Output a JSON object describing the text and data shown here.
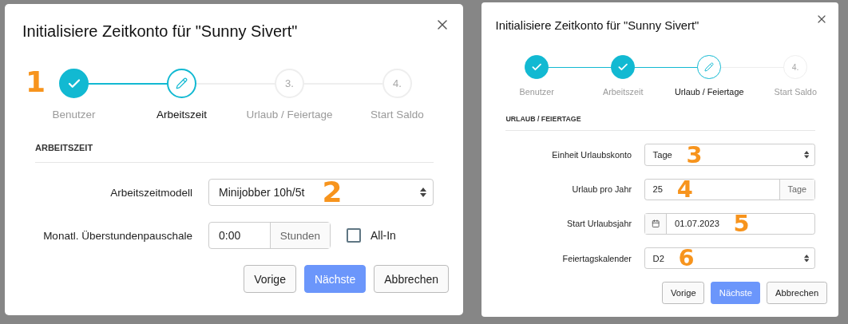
{
  "panels": [
    {
      "title": "Initialisiere Zeitkonto für \"Sunny Sivert\"",
      "step_annotation": "1",
      "steps": [
        {
          "label": "Benutzer",
          "done": true,
          "selected": false
        },
        {
          "label": "Arbeitszeit",
          "done": false,
          "selected": true
        },
        {
          "label": "Urlaub / Feiertage",
          "done": false,
          "selected": false,
          "number": "3."
        },
        {
          "label": "Start Saldo",
          "done": false,
          "selected": false,
          "number": "4."
        }
      ],
      "section": "ARBEITSZEIT",
      "fields": [
        {
          "kind": "select",
          "label": "Arbeitszeitmodell",
          "value": "Minijobber 10h/5t",
          "annotation": "2"
        },
        {
          "kind": "unit",
          "label": "Monatl. Überstundenpauschale",
          "value": "0:00",
          "unit": "Stunden",
          "checkbox": {
            "label": "All-In",
            "checked": false
          }
        }
      ],
      "buttons": [
        {
          "label": "Vorige",
          "kind": "secondary"
        },
        {
          "label": "Nächste",
          "kind": "primary"
        },
        {
          "label": "Abbrechen",
          "kind": "secondary"
        }
      ]
    },
    {
      "title": "Initialisiere Zeitkonto für \"Sunny Sivert\"",
      "steps": [
        {
          "label": "Benutzer",
          "done": true,
          "selected": false
        },
        {
          "label": "Arbeitszeit",
          "done": true,
          "selected": false
        },
        {
          "label": "Urlaub / Feiertage",
          "done": false,
          "selected": true
        },
        {
          "label": "Start Saldo",
          "done": false,
          "selected": false,
          "number": "4."
        }
      ],
      "section": "URLAUB / FEIERTAGE",
      "fields": [
        {
          "kind": "select",
          "label": "Einheit Urlaubskonto",
          "value": "Tage",
          "annotation": "3"
        },
        {
          "kind": "unit",
          "label": "Urlaub pro Jahr",
          "value": "25",
          "unit": "Tage",
          "annotation": "4"
        },
        {
          "kind": "date",
          "label": "Start Urlaubsjahr",
          "value": "01.07.2023",
          "annotation": "5"
        },
        {
          "kind": "select",
          "label": "Feiertagskalender",
          "value": "D2",
          "annotation": "6"
        }
      ],
      "buttons": [
        {
          "label": "Vorige",
          "kind": "secondary"
        },
        {
          "label": "Nächste",
          "kind": "primary"
        },
        {
          "label": "Abbrechen",
          "kind": "secondary"
        }
      ]
    }
  ]
}
